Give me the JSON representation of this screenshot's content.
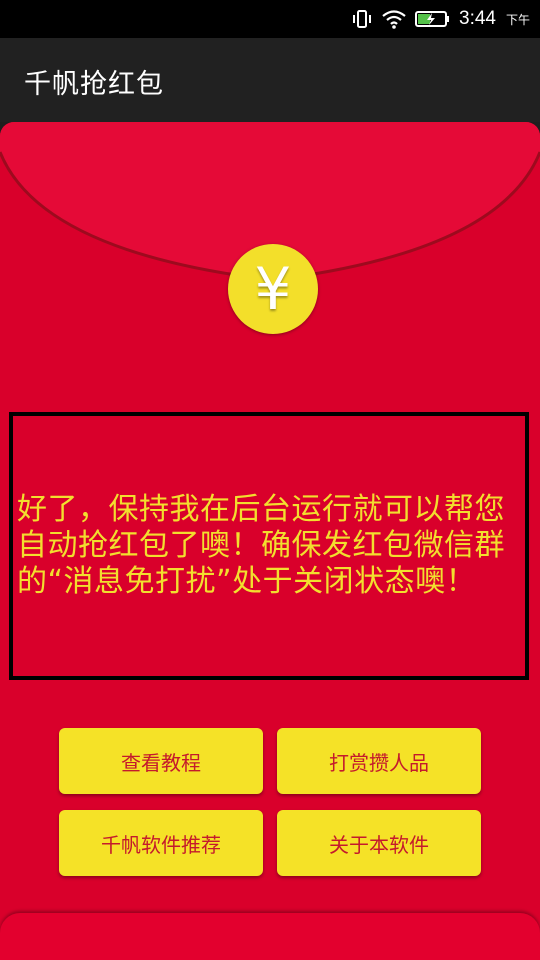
{
  "status_bar": {
    "time": "3:44",
    "ampm": "下午"
  },
  "app_bar": {
    "title": "千帆抢红包"
  },
  "envelope": {
    "coin_symbol": "¥",
    "message": "好了，保持我在后台运行就可以帮您自动抢红包了噢！确保发红包微信群的“消息免打扰”处于关闭状态噢！"
  },
  "buttons": {
    "tutorial": "查看教程",
    "reward": "打赏攒人品",
    "recommend": "千帆软件推荐",
    "about": "关于本软件"
  },
  "colors": {
    "envelope_red": "#d9002b",
    "button_yellow": "#f5e227",
    "button_text": "#c41a2c",
    "message_text": "#f2df2e"
  }
}
